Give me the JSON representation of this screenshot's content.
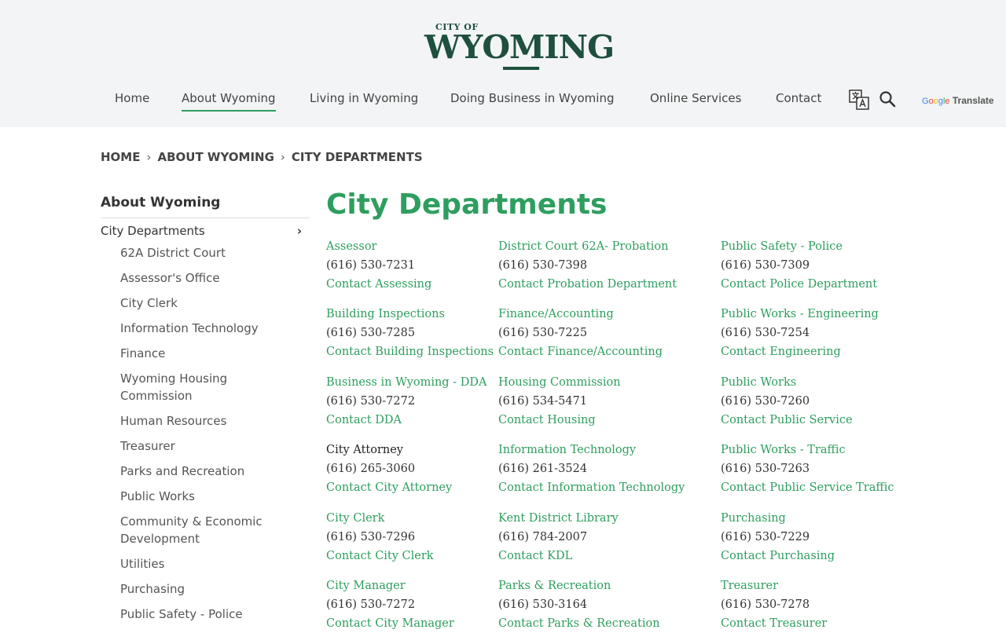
{
  "logo": {
    "small": "CITY OF",
    "big": "WYOMING"
  },
  "nav": {
    "items": [
      {
        "label": "Home"
      },
      {
        "label": "About Wyoming"
      },
      {
        "label": "Living in Wyoming"
      },
      {
        "label": "Doing Business in Wyoming"
      },
      {
        "label": "Online Services"
      },
      {
        "label": "Contact"
      }
    ],
    "google": "Google",
    "translate": "Translate"
  },
  "breadcrumb": {
    "home": "HOME",
    "about": "ABOUT WYOMING",
    "current": "CITY DEPARTMENTS",
    "sep": "›"
  },
  "sidebar": {
    "title": "About Wyoming",
    "current": "City Departments",
    "chevron": "›",
    "items": [
      {
        "label": "62A District Court"
      },
      {
        "label": "Assessor's Office"
      },
      {
        "label": "City Clerk"
      },
      {
        "label": "Information Technology"
      },
      {
        "label": "Finance"
      },
      {
        "label": "Wyoming Housing Commission"
      },
      {
        "label": "Human Resources"
      },
      {
        "label": "Treasurer"
      },
      {
        "label": "Parks and Recreation"
      },
      {
        "label": "Public Works"
      },
      {
        "label": "Community & Economic Development"
      },
      {
        "label": "Utilities"
      },
      {
        "label": "Purchasing"
      },
      {
        "label": "Public Safety - Police"
      }
    ]
  },
  "main": {
    "title": "City Departments",
    "columns": [
      [
        {
          "name": "Assessor",
          "phone": "(616) 530-7231",
          "contact": "Contact Assessing"
        },
        {
          "name": "Building Inspections",
          "phone": "(616) 530-7285",
          "contact": "Contact Building Inspections"
        },
        {
          "name": "Business in Wyoming - DDA",
          "phone": "(616) 530-7272",
          "contact": "Contact DDA"
        },
        {
          "name": "City Attorney",
          "phone": "(616) 265-3060",
          "contact": "Contact City Attorney"
        },
        {
          "name": "City Clerk",
          "phone": "(616) 530-7296",
          "contact": "Contact City Clerk"
        },
        {
          "name": "City Manager",
          "phone": "(616) 530-7272",
          "contact": "Contact City Manager"
        }
      ],
      [
        {
          "name": "District Court 62A- Probation",
          "phone": "(616) 530-7398",
          "contact": "Contact Probation Department"
        },
        {
          "name": "Finance/Accounting",
          "phone": "(616) 530-7225",
          "contact": "Contact Finance/Accounting"
        },
        {
          "name": "Housing Commission",
          "phone": "(616) 534-5471",
          "contact": "Contact Housing"
        },
        {
          "name": "Information Technology",
          "phone": "(616) 261-3524",
          "contact": "Contact Information Technology"
        },
        {
          "name": "Kent District Library",
          "phone": "(616) 784-2007",
          "contact": "Contact KDL"
        },
        {
          "name": "Parks & Recreation",
          "phone": "(616) 530-3164",
          "contact": "Contact Parks & Recreation"
        }
      ],
      [
        {
          "name": "Public Safety - Police",
          "phone": "(616) 530-7309",
          "contact": "Contact Police Department"
        },
        {
          "name": "Public Works - Engineering",
          "phone": "(616) 530-7254",
          "contact": "Contact Engineering"
        },
        {
          "name": "Public Works",
          "phone": "(616) 530-7260",
          "contact": "Contact Public Service"
        },
        {
          "name": "Public Works - Traffic",
          "phone": "(616) 530-7263",
          "contact": "Contact Public Service Traffic"
        },
        {
          "name": "Purchasing",
          "phone": "(616) 530-7229",
          "contact": "Contact Purchasing"
        },
        {
          "name": "Treasurer",
          "phone": "(616) 530-7278",
          "contact": "Contact Treasurer"
        }
      ]
    ]
  },
  "colors": {
    "accent": "#2e9e5e",
    "brand": "#1f4f3e"
  },
  "icons": [
    "translate-icon",
    "search-icon",
    "chevron-right-icon"
  ]
}
